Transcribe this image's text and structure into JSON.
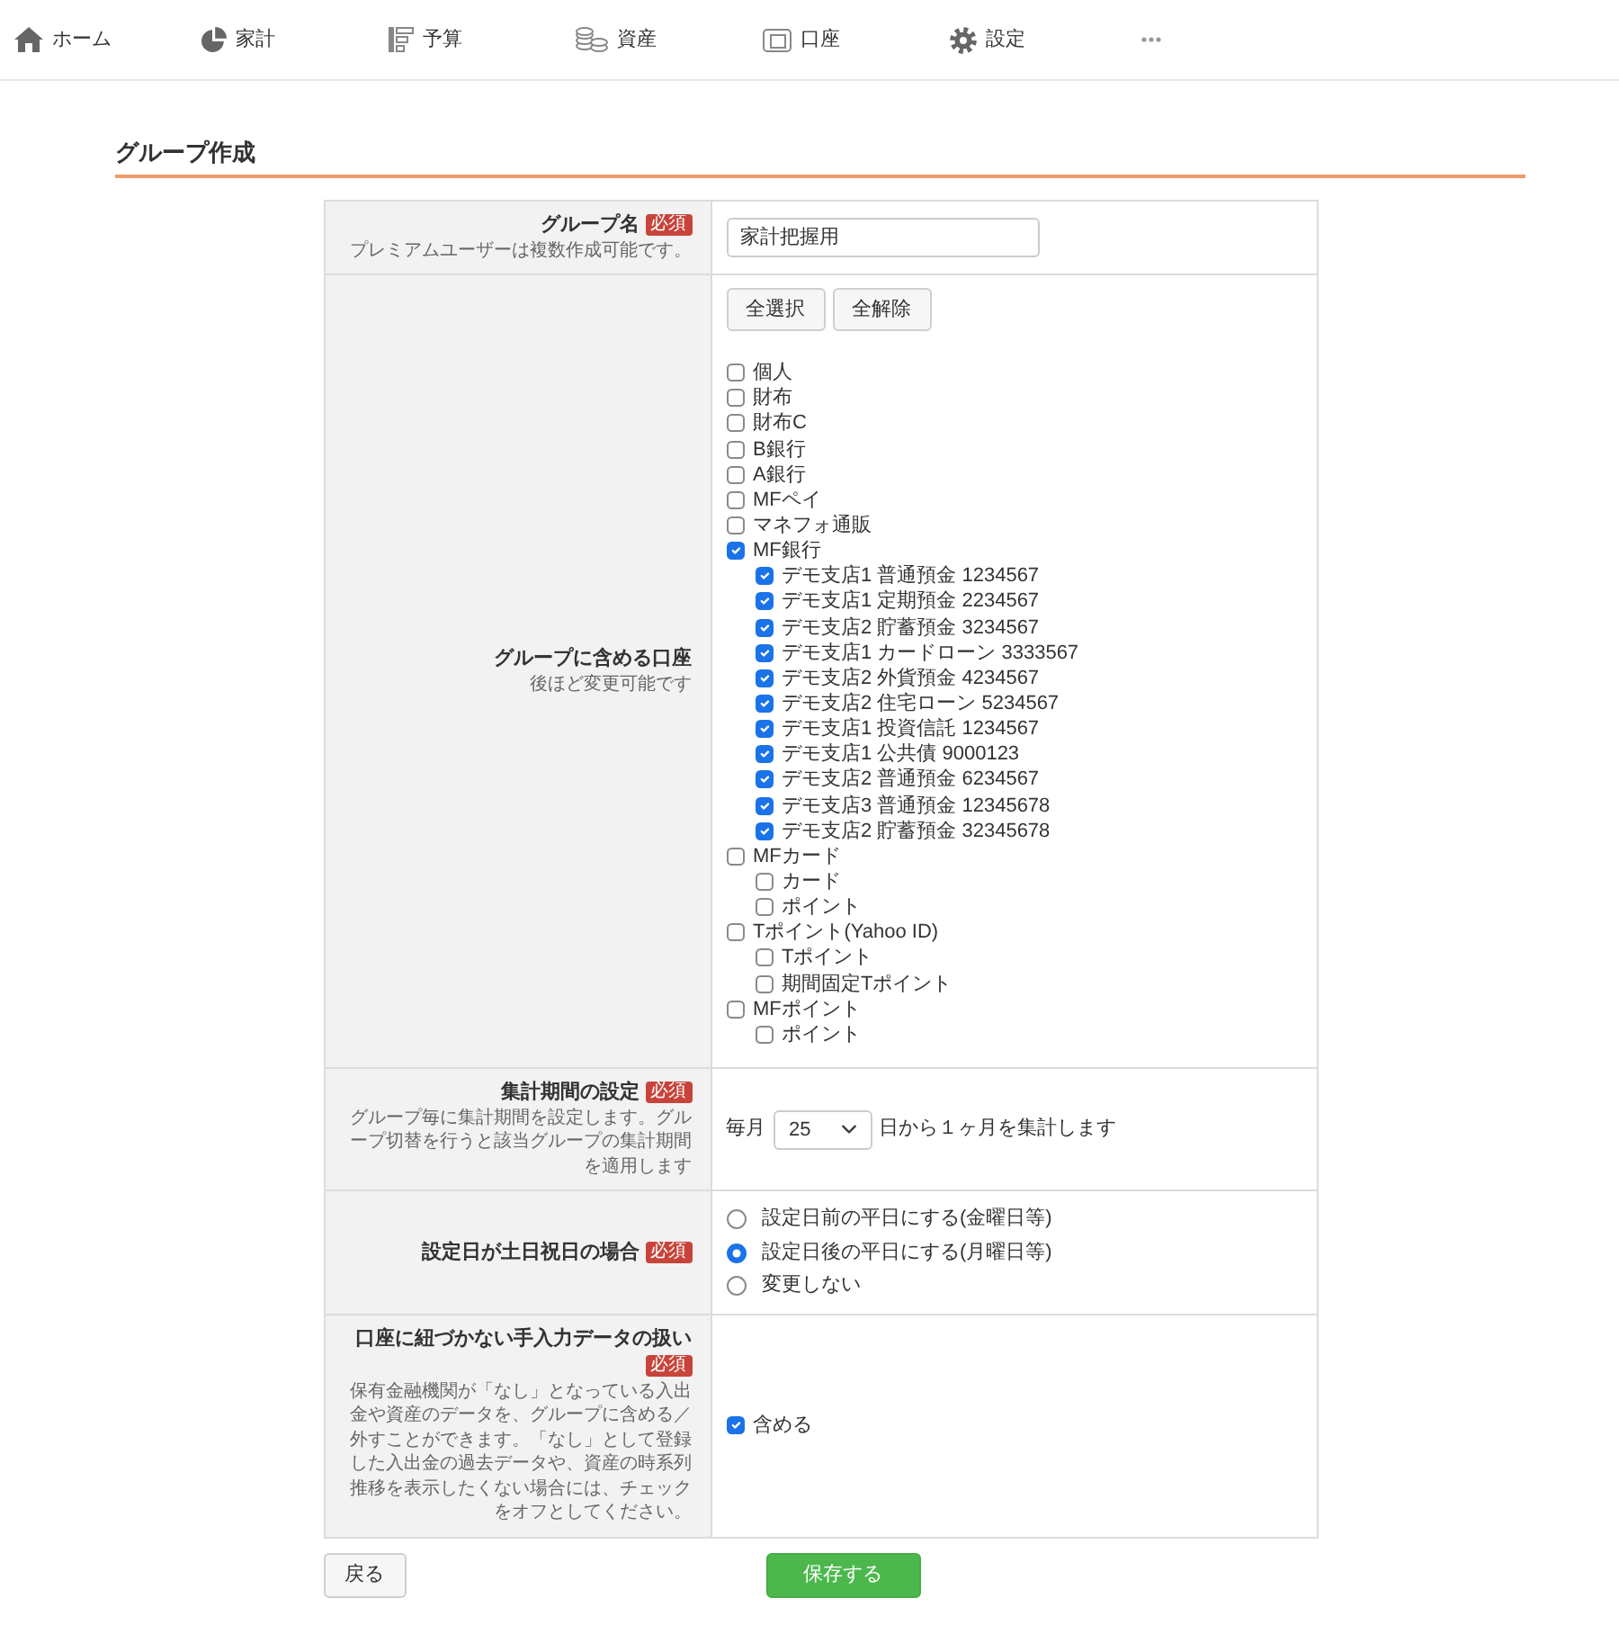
{
  "nav": [
    "ホーム",
    "家計",
    "予算",
    "資産",
    "口座",
    "設定"
  ],
  "page_title": "グループ作成",
  "form": {
    "group_name": {
      "label": "グループ名",
      "badge": "必須",
      "note": "プレミアムユーザーは複数作成可能です。",
      "value": "家計把握用"
    },
    "accounts": {
      "label": "グループに含める口座",
      "note": "後ほど変更可能です",
      "buttons": [
        "全選択",
        "全解除"
      ],
      "tree": [
        {
          "label": "個人",
          "checked": false
        },
        {
          "label": "財布",
          "checked": false
        },
        {
          "label": "財布C",
          "checked": false
        },
        {
          "label": "B銀行",
          "checked": false
        },
        {
          "label": "A銀行",
          "checked": false
        },
        {
          "label": "MFペイ",
          "checked": false
        },
        {
          "label": "マネフォ通販",
          "checked": false
        },
        {
          "label": "MF銀行",
          "checked": true,
          "children": [
            {
              "label": "デモ支店1 普通預金 1234567",
              "checked": true
            },
            {
              "label": "デモ支店1 定期預金 2234567",
              "checked": true
            },
            {
              "label": "デモ支店2 貯蓄預金 3234567",
              "checked": true
            },
            {
              "label": "デモ支店1 カードローン 3333567",
              "checked": true
            },
            {
              "label": "デモ支店2 外貨預金 4234567",
              "checked": true
            },
            {
              "label": "デモ支店2 住宅ローン 5234567",
              "checked": true
            },
            {
              "label": "デモ支店1 投資信託 1234567",
              "checked": true
            },
            {
              "label": "デモ支店1 公共債 9000123",
              "checked": true
            },
            {
              "label": "デモ支店2 普通預金 6234567",
              "checked": true
            },
            {
              "label": "デモ支店3 普通預金 12345678",
              "checked": true
            },
            {
              "label": "デモ支店2 貯蓄預金 32345678",
              "checked": true
            }
          ]
        },
        {
          "label": "MFカード",
          "checked": false,
          "children": [
            {
              "label": "カード",
              "checked": false
            },
            {
              "label": "ポイント",
              "checked": false
            }
          ]
        },
        {
          "label": "Tポイント(Yahoo ID)",
          "checked": false,
          "children": [
            {
              "label": "Tポイント",
              "checked": false
            },
            {
              "label": "期間固定Tポイント",
              "checked": false
            }
          ]
        },
        {
          "label": "MFポイント",
          "checked": false,
          "children": [
            {
              "label": "ポイント",
              "checked": false
            }
          ]
        }
      ]
    },
    "period": {
      "label": "集計期間の設定",
      "badge": "必須",
      "note": "グループ毎に集計期間を設定します。グループ切替を行うと該当グループの集計期間を適用します",
      "prefix": "毎月",
      "day": "25",
      "suffix": "日から１ヶ月を集計します"
    },
    "holiday": {
      "label": "設定日が土日祝日の場合",
      "badge": "必須",
      "options": [
        {
          "label": "設定日前の平日にする(金曜日等)",
          "selected": false
        },
        {
          "label": "設定日後の平日にする(月曜日等)",
          "selected": true
        },
        {
          "label": "変更しない",
          "selected": false
        }
      ]
    },
    "manual_data": {
      "label": "口座に紐づかない手入力データの扱い",
      "badge": "必須",
      "note": "保有金融機関が「なし」となっている入出金や資産のデータを、グループに含める／外すことができます。「なし」として登録した入出金の過去データや、資産の時系列推移を表示したくない場合には、チェックをオフとしてください。",
      "option": {
        "label": "含める",
        "checked": true
      }
    }
  },
  "back_button": "戻る",
  "save_button": "保存する"
}
